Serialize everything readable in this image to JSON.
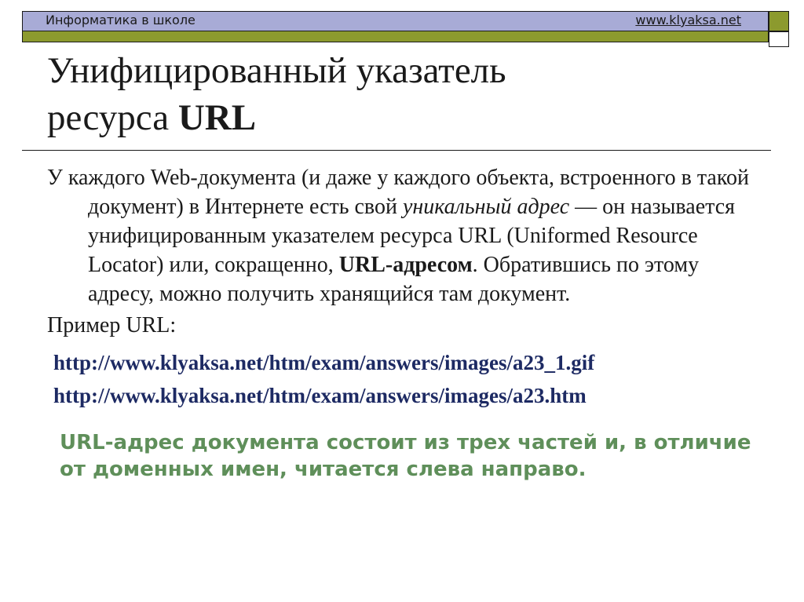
{
  "header": {
    "site_name": "Информатика в школе",
    "site_url": "www.klyaksa.net"
  },
  "title": {
    "line1": "Унифицированный указатель",
    "line2_prefix": "ресурса ",
    "line2_bold": "URL"
  },
  "body": {
    "part1": "У каждого Web-документа (и даже у каждого объекта, встроенного в такой документ) в Интернете есть свой ",
    "italic": "уникальный адрес",
    "part2": " — он называется унифицированным указателем ресурса URL (Uniformed Resource Locator) или, сокращенно, ",
    "bold": "URL-адресом",
    "part3": ". Обратившись по этому адресу, можно получить хранящийся там документ."
  },
  "example": {
    "label": "Пример URL:",
    "urls": [
      "http://www.klyaksa.net/htm/exam/answers/images/a23_1.gif",
      "http://www.klyaksa.net/htm/exam/answers/images/a23.htm"
    ]
  },
  "note": "URL-адрес документа состоит из трех частей и, в отличие от доменных имен, читается слева направо.",
  "colors": {
    "header_bar": "#a8abd6",
    "header_accent": "#8c9a2e",
    "url_text": "#1d2a63",
    "note_text": "#5f8f5a"
  }
}
